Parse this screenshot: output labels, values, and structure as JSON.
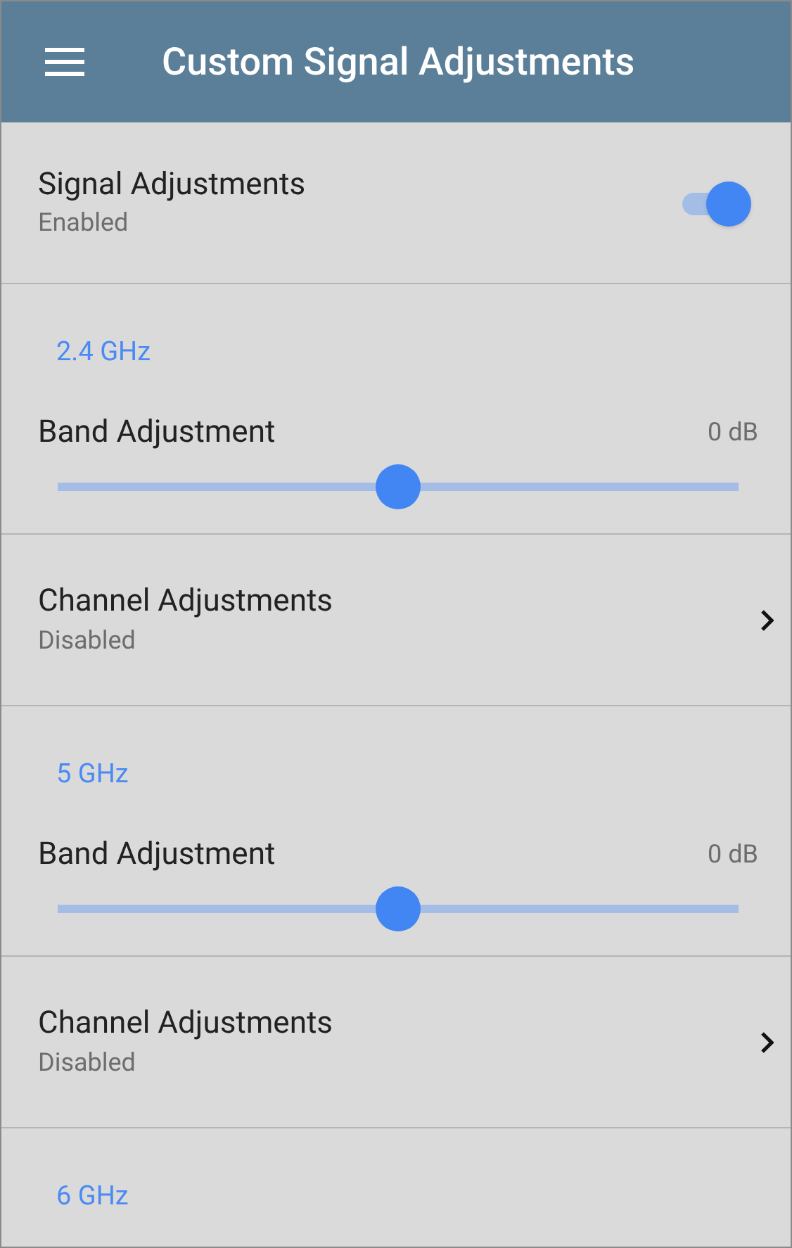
{
  "app_bar": {
    "title": "Custom Signal Adjustments"
  },
  "items": [
    {
      "kind": "toggle",
      "title": "Signal Adjustments",
      "subtitle": "Enabled",
      "on": true
    },
    {
      "kind": "section",
      "label": "2.4 GHz"
    },
    {
      "kind": "slider",
      "title": "Band Adjustment",
      "reading": "0 dB",
      "level": 0.5
    },
    {
      "kind": "nav",
      "title": "Channel Adjustments",
      "subtitle": "Disabled"
    },
    {
      "kind": "section",
      "label": "5 GHz"
    },
    {
      "kind": "slider",
      "title": "Band Adjustment",
      "reading": "0 dB",
      "level": 0.5
    },
    {
      "kind": "nav",
      "title": "Channel Adjustments",
      "subtitle": "Disabled"
    },
    {
      "kind": "section",
      "label": "6 GHz"
    }
  ]
}
